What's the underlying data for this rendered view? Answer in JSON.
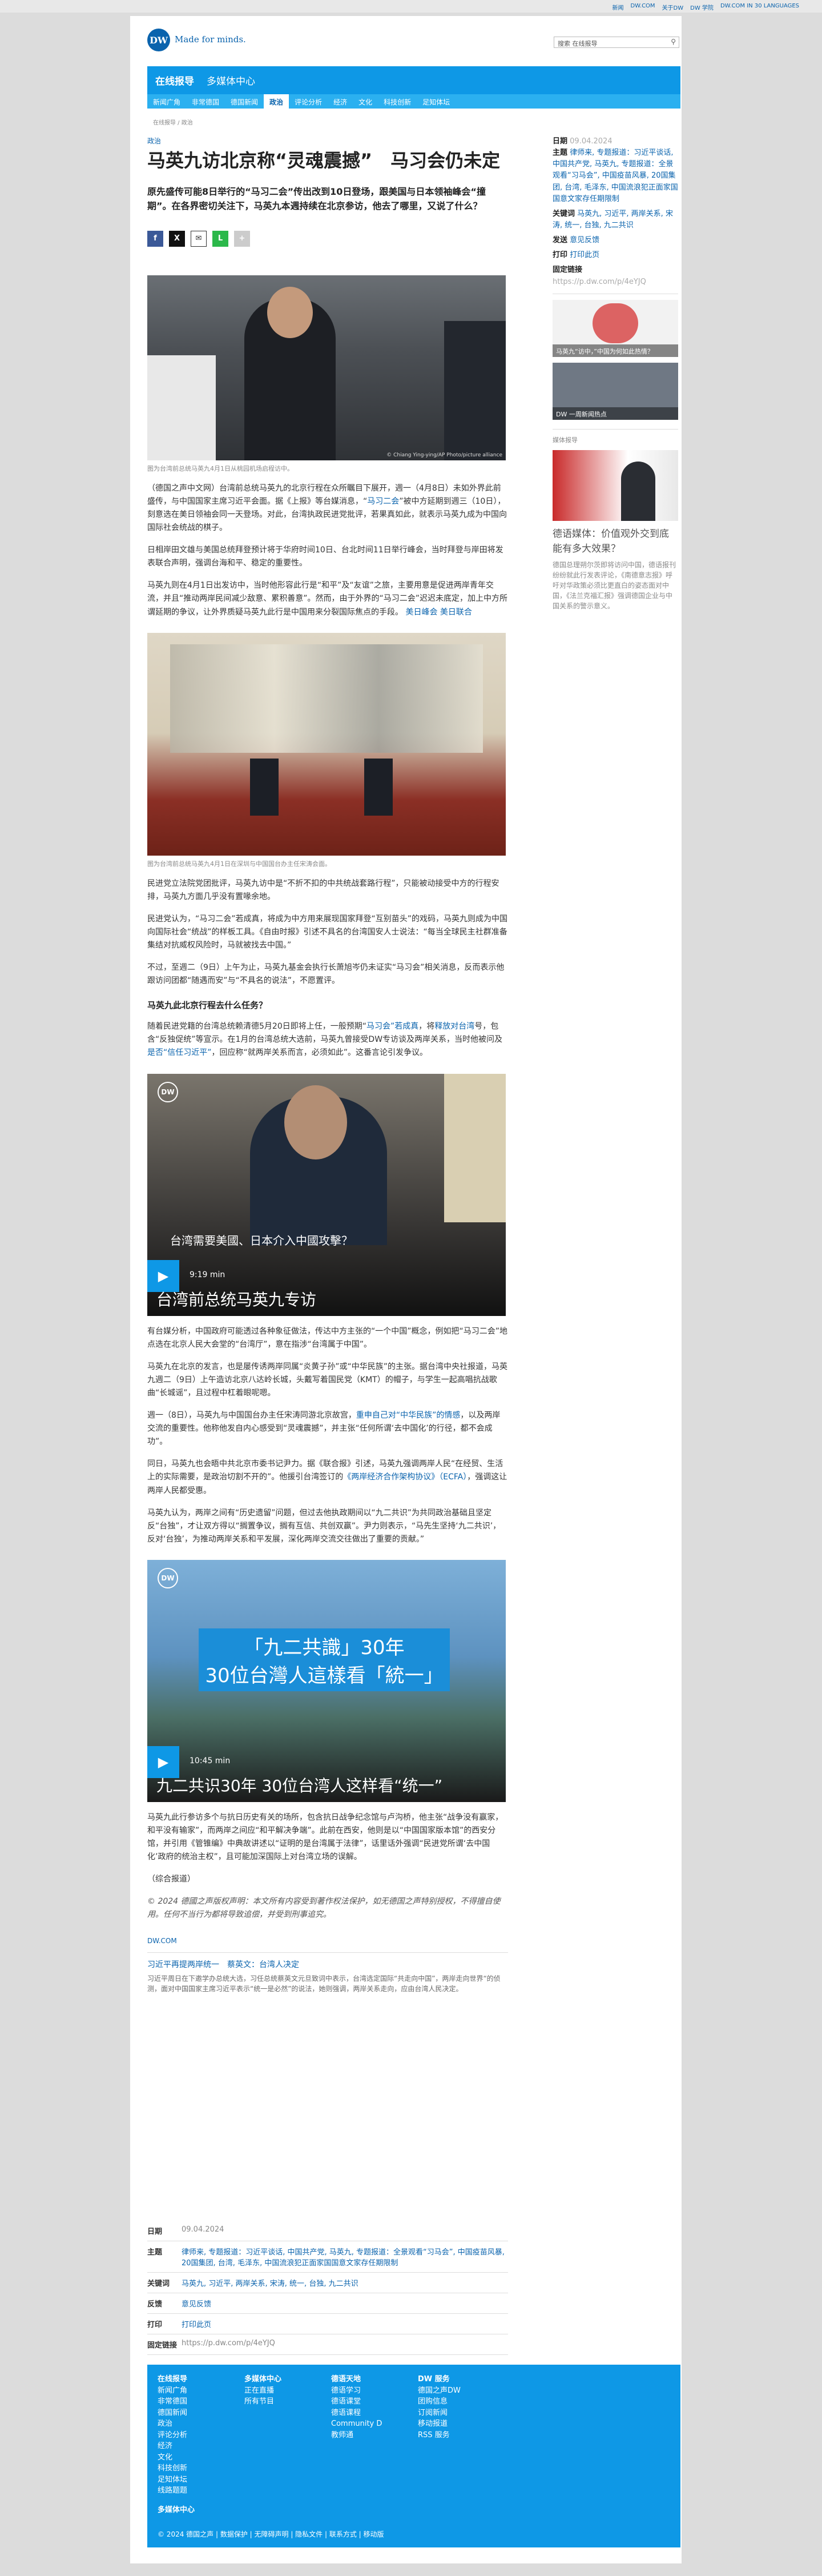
{
  "topbar": {
    "links": [
      "新闻",
      "DW.COM",
      "关于DW",
      "DW 学院",
      "DW.COM IN 30 LANGUAGES"
    ]
  },
  "header": {
    "logo": "DW",
    "tagline": "Made for minds.",
    "search_placeholder": "搜索 在线报导"
  },
  "nav": {
    "primary": [
      "在线报导",
      "多媒体中心"
    ],
    "secondary": [
      "新闻广角",
      "非常德国",
      "德国新闻",
      "政治",
      "评论分析",
      "经济",
      "文化",
      "科技创新",
      "足知体坛"
    ],
    "active": "政治"
  },
  "breadcrumb": "在线报导 / 政治",
  "article": {
    "category": "政治",
    "title": "马英九访北京称“灵魂震撼”　马习会仍未定",
    "lead": "原先盛传可能8日举行的“马习二会”传出改到10日登场，跟美国与日本领袖峰会“撞期”。在各界密切关注下，马英九本週持续在北京参访，他去了哪里，又说了什么？",
    "photo1_caption": "图为台湾前总统马英九4月1日从桃园机场启程访中。",
    "photo1_credit": "© Chiang Ying-ying/AP Photo/picture alliance",
    "p1": "（德国之声中文网）台湾前总统马英九的北京行程在众所瞩目下展开，週一（4月8日）未如外界此前盛传，与中国国家主席习近平会面。据《上报》等台媒消息，“",
    "p1_link": "马习二会",
    "p1_rest": "”被中方延期到週三（10日），刻意选在美日领袖会同一天登场。对此，台湾执政民进党批评，若果真如此，就表示马英九成为中国向国际社会统战的棋子。",
    "p2": "日相岸田文雄与美国总统拜登预计将于华府时间10日、台北时间11日举行峰会，当时拜登与岸田将发表联合声明，强调台海和平、稳定的重要性。",
    "p3_a": "马英九则在4月1日出发访中，当时他形容此行是“和平”及“友谊”之旅，主要用意是促进两岸青年交流，并且“推动两岸民间减少敌意、累积善意”。然而，由于外界的“马习二会”迟迟未底定，加上中方所谓延期的争议，让外界质疑马英九此行是中国用来分裂国际焦点的手段。",
    "p3_links": [
      "美日峰会",
      "美日联合"
    ],
    "photo2_caption": "图为台湾前总统马英九4月1日在深圳与中国国台办主任宋涛会面。",
    "p4": "民进党立法院党团批评，马英九访中是“不折不扣的中共统战套路行程”，只能被动接受中方的行程安排，马英九方面几乎没有置喙余地。",
    "p5": "民进党认为，“马习二会”若成真，将成为中方用来展现国家拜登“互别苗头”的戏码，马英九则成为中国向国际社会“统战”的样板工具。《自由时报》引述不具名的台湾国安人士说法：“每当全球民主社群准备集结对抗威权风险时，马就被找去中国。”",
    "p6": "不过，至週二（9日）上午为止，马英九基金会执行长萧旭岑仍未证实“马习会”相关消息，反而表示他跟访问团都“随遇而安”与“不具名的说法”，不愿置评。",
    "subhead": "马英九此北京行程去什么任务？",
    "p7_a": "随着民进党籍的台湾总统赖清德5月20日即将上任，一般预期“",
    "p7_link1": "马习会”若成真",
    "p7_b": "，将",
    "p7_link2": "释放对台湾",
    "p7_c": "号，包含“反独促统”等宣示。在1月的台湾总统大选前，马英九曾接受DW专访谈及两岸关系，当时他被问及",
    "p7_link3": "是否“信任习近平”",
    "p7_d": "，回应称“就两岸关系而言，必须如此”。这番言论引发争议。",
    "video1": {
      "label": "台湾需要美國、日本介入中國攻擊？",
      "duration": "9:19 min",
      "title": "台湾前总统马英九专访"
    },
    "p8": "有台媒分析，中国政府可能透过各种象征做法，传达中方主张的“一个中国”概念，例如把“马习二会”地点选在北京人民大会堂的“台湾厅”，意在指涉“台湾属于中国”。",
    "p9": "马英九在北京的发言，也是屡传诱两岸同属“炎黄子孙”或“中华民族”的主张。据台湾中央社报道，马英九週二（9日）上午造访北京八达岭长城，头戴写着国民党（KMT）的帽子，与学生一起高唱抗战歌曲“长城谣”，且过程中杠着眼呢嗯。",
    "p10_a": "週一（8日），马英九与中国国台办主任宋涛同游北京故宫，",
    "p10_link": "重申自己对“中华民族”的情感",
    "p10_b": "，以及两岸交流的重要性。他称他发自内心感受到“灵魂震撼”，并主张“任何所谓‘去中国化’的行径，都不会成功”。",
    "p11_a": "同日，马英九也会晤中共北京市委书记尹力。据《联合报》引述，马英九强调两岸人民“在经贸、生活上的实际需要，是政治切割不开的”。他援引台湾签订的",
    "p11_link": "《两岸经济合作架构协议》（ECFA）",
    "p11_b": "，强调这让两岸人民都受惠。",
    "p12": "马英九认为，两岸之间有“历史遗留”问题，但过去他执政期间以“九二共识”为共同政治基础且坚定反“台独”，才让双方得以“搁置争议，搁有互信、共创双赢”。尹力则表示，“马先生坚持‘九二共识’，反对‘台独’，为推动两岸关系和平发展，深化两岸交流交往做出了重要的贡献。”",
    "video2": {
      "label_line1": "「九二共識」30年",
      "label_line2": "30位台灣人這樣看「統一」",
      "duration": "10:45 min",
      "title": "九二共识30年 30位台湾人这样看“统一”"
    },
    "p13": "马英九此行参访多个与抗日历史有关的场所，包含抗日战争纪念馆与卢沟桥，他主张“战争没有赢家，和平没有输家”，而两岸之间应“和平解决争端”。此前在西安，他则是以“中国国家版本馆”的西安分馆，并引用《管锥编》中典故讲述以“证明的是台湾属于法律”，话里话外强调“民进党所谓‘去中国化’政府的统治主权”，且可能加深国际上对台湾立场的误解。",
    "source_note": "（综合报道）",
    "copyright": "© 2024 德國之声版权声明：本文所有内容受到著作权法保护，如无德国之声特别授权，不得擅自使用。任何不当行为都将导致追偿，并受到刑事追究。",
    "dwcom": "DW.COM",
    "related_title": "习近平再提两岸统一　蔡英文：台湾人决定",
    "related_text": "习近平周日在下邀学办总统大选，习任总统蔡英文元旦致词中表示，台湾选定国际“共走向中国”，两岸走向世界“的侦测，面对中国国家主席习近平表示“统一是必然”的说法，她则强调，两岸关系走向，应由台湾人民决定。"
  },
  "meta": {
    "date_label": "日期",
    "date": "09.04.2024",
    "topic_label": "主题",
    "topics": "律师来, 专题报道：习近平谈话, 中国共产党, 马英九, 专题报道：全景观看“习马会”, 中国疫苗风暴, 20国集团, 台湾, 毛泽东, 中国流浪犯正面家国国意文家存任期限制",
    "keywords_label": "关键词",
    "keywords": "马英九, 习近平, 两岸关系, 宋涛, 统一, 台独, 九二共识",
    "feedback_label": "反馈",
    "feedback": "意见反馈",
    "print_label": "打印",
    "print": "打印此页",
    "permalink_label": "固定链接",
    "permalink": "https://p.dw.com/p/4eYJQ"
  },
  "sidebar": {
    "date_label": "日期",
    "date": "09.04.2024",
    "topic_label": "主题",
    "topics": "律师来, 专题报道：习近平谈话, 中国共产党, 马英九, 专题报道：全景观看“习马会”, 中国疫苗风暴, 20国集团, 台湾, 毛泽东, 中国流浪犯正面家国国意文家存任期限制",
    "keywords_label": "关键词",
    "keywords": "马英九, 习近平, 两岸关系, 宋涛, 统一, 台独, 九二共识",
    "send_label": "发送",
    "send": "意见反馈",
    "print_label": "打印",
    "print": "打印此页",
    "permalink_label": "固定链接",
    "permalink": "https://p.dw.com/p/4eYJQ",
    "img1_caption": "马英九“访中，”中国为何如此热情？",
    "img2_caption": "DW 一周新闻热点",
    "related_label": "媒体报导",
    "story_title": "德语媒体：价值观外交到底能有多大效果？",
    "story_text": "德国总理朔尔茨即将访问中国，德语报刊纷纷就此行发表评论，《南德意志报》呼吁对华政策必须比更直白的姿态面对中国，《法兰克福汇报》强调德国企业与中国关系的警示意义。"
  },
  "footer": {
    "col1_title": "在线报导",
    "col1": [
      "新闻广角",
      "非常德国",
      "德国新闻",
      "政治",
      "评论分析",
      "经济",
      "文化",
      "科技创新",
      "足知体坛",
      "线路题题"
    ],
    "col1_extra": "多媒体中心",
    "col2_title": "多媒体中心",
    "col2": [
      "正在直播",
      "所有节目"
    ],
    "col3_title": "德语天地",
    "col3": [
      "德语学习",
      "德语课堂",
      "德语课程",
      "Community D",
      "教师通"
    ],
    "col4_title": "DW 服务",
    "col4": [
      "德国之声DW",
      "团购信息",
      "订阅新闻",
      "移动报道",
      "RSS 服务"
    ],
    "copyright": "© 2024 德国之声 | 数据保护 | 无障碍声明 | 隐私文件 | 联系方式 | 移动版"
  },
  "colors": {
    "brand": "#0a63ad",
    "nav": "#0e98e6",
    "nav2": "#2bb0f0"
  }
}
